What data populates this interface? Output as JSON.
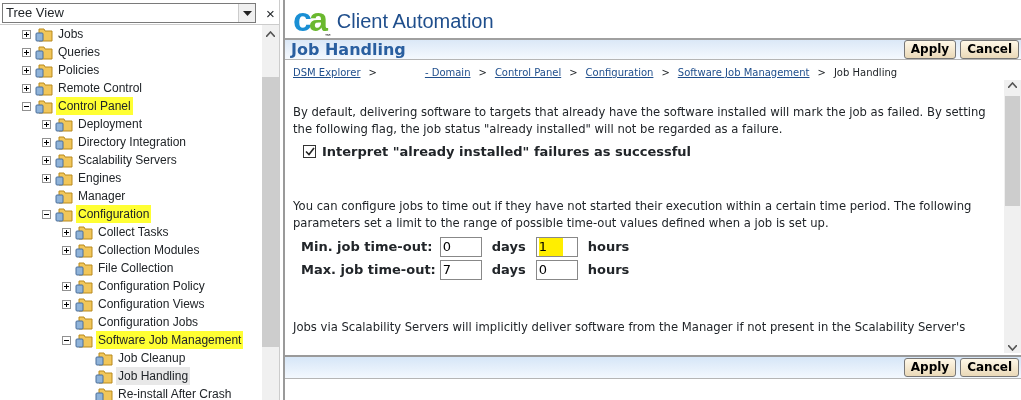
{
  "sidebar": {
    "view_selector": "Tree View",
    "close": "×",
    "tree": [
      {
        "label": "Jobs",
        "expanded": false,
        "highlighted": false,
        "selected": false
      },
      {
        "label": "Queries",
        "expanded": false,
        "highlighted": false,
        "selected": false
      },
      {
        "label": "Policies",
        "expanded": false,
        "highlighted": false,
        "selected": false
      },
      {
        "label": "Remote Control",
        "expanded": false,
        "highlighted": false,
        "selected": false
      },
      {
        "label": "Control Panel",
        "expanded": true,
        "highlighted": true,
        "selected": false,
        "children": [
          {
            "label": "Deployment",
            "expanded": false,
            "highlighted": false,
            "selected": false
          },
          {
            "label": "Directory Integration",
            "expanded": false,
            "highlighted": false,
            "selected": false
          },
          {
            "label": "Scalability Servers",
            "expanded": false,
            "highlighted": false,
            "selected": false
          },
          {
            "label": "Engines",
            "expanded": false,
            "highlighted": false,
            "selected": false
          },
          {
            "label": "Manager",
            "highlighted": false,
            "selected": false
          },
          {
            "label": "Configuration",
            "expanded": true,
            "highlighted": true,
            "selected": false,
            "children": [
              {
                "label": "Collect Tasks",
                "expanded": false,
                "highlighted": false,
                "selected": false
              },
              {
                "label": "Collection Modules",
                "expanded": false,
                "highlighted": false,
                "selected": false
              },
              {
                "label": "File Collection",
                "highlighted": false,
                "selected": false
              },
              {
                "label": "Configuration Policy",
                "expanded": false,
                "highlighted": false,
                "selected": false
              },
              {
                "label": "Configuration Views",
                "expanded": false,
                "highlighted": false,
                "selected": false
              },
              {
                "label": "Configuration Jobs",
                "highlighted": false,
                "selected": false
              },
              {
                "label": "Software Job Management",
                "expanded": true,
                "highlighted": true,
                "selected": false,
                "children": [
                  {
                    "label": "Job Cleanup",
                    "highlighted": false,
                    "selected": false
                  },
                  {
                    "label": "Job Handling",
                    "highlighted": false,
                    "selected": true
                  },
                  {
                    "label": "Re-install After Crash",
                    "highlighted": false,
                    "selected": false
                  }
                ]
              }
            ]
          }
        ]
      }
    ]
  },
  "header": {
    "logo": "ca",
    "trademark": "™",
    "product": "Client Automation"
  },
  "page": {
    "title": "Job Handling",
    "buttons": [
      "Apply",
      "Cancel"
    ],
    "breadcrumb": [
      {
        "label": "DSM Explorer",
        "link": true
      },
      {
        "label": "- Domain",
        "link": true
      },
      {
        "label": "Control Panel",
        "link": true
      },
      {
        "label": "Configuration",
        "link": true
      },
      {
        "label": "Software Job Management",
        "link": true
      },
      {
        "label": "Job Handling",
        "link": false
      }
    ],
    "separator": ">",
    "intro": "By default, delivering software to targets that already have the software installed will mark the job as failed. By setting the following flag, the job status \"already installed\" will not be regarded as a failure.",
    "checkbox": {
      "label": "Interpret \"already installed\" failures as successful",
      "checked": true
    },
    "timeout_intro": "You can configure jobs to time out if they have not started their execution within a certain time period. The following parameters set a limit to the range of possible time-out values defined when a job is set up.",
    "timeouts": [
      {
        "label": "Min. job time-out:",
        "days": "0",
        "days_unit": "days",
        "hours": "1",
        "hours_unit": "hours",
        "highlighted": true
      },
      {
        "label": "Max. job time-out:",
        "days": "7",
        "days_unit": "days",
        "hours": "0",
        "hours_unit": "hours",
        "highlighted": false
      }
    ],
    "footer_text": "Jobs via Scalability Servers will implicitly deliver software from the Manager if not present in the Scalability Server's",
    "bottom_buttons": [
      "Apply",
      "Cancel"
    ]
  }
}
